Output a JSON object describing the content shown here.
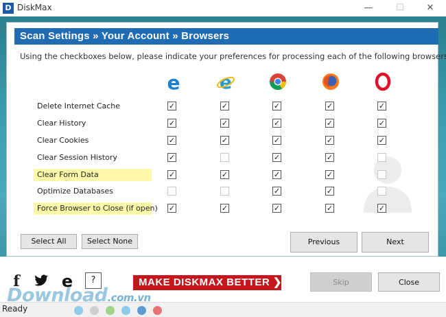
{
  "window": {
    "title": "DiskMax",
    "logo_letter": "D",
    "controls": {
      "minimize": "—",
      "maximize": "☐",
      "close": "✕"
    }
  },
  "header": {
    "title": "Scan Settings  »  Your Account  » Browsers"
  },
  "instructions": "Using the checkboxes below, please indicate your preferences for processing each of the following browsers:",
  "browsers": [
    "edge-icon",
    "internet-explorer-icon",
    "chrome-icon",
    "firefox-icon",
    "opera-icon"
  ],
  "rows": [
    {
      "label": "Delete Internet Cache",
      "highlight": false,
      "checks": [
        true,
        true,
        true,
        true,
        true
      ]
    },
    {
      "label": "Clear History",
      "highlight": false,
      "checks": [
        true,
        true,
        true,
        true,
        true
      ]
    },
    {
      "label": "Clear Cookies",
      "highlight": false,
      "checks": [
        true,
        true,
        true,
        true,
        true
      ]
    },
    {
      "label": "Clear Session History",
      "highlight": false,
      "checks": [
        true,
        false,
        true,
        true,
        false
      ]
    },
    {
      "label": "Clear Form Data",
      "highlight": true,
      "checks": [
        true,
        true,
        true,
        true,
        false
      ]
    },
    {
      "label": "Optimize Databases",
      "highlight": false,
      "checks": [
        false,
        false,
        true,
        true,
        false
      ]
    },
    {
      "label": "Force Browser to Close (if open)",
      "highlight": true,
      "checks": [
        true,
        true,
        true,
        true,
        true
      ]
    }
  ],
  "buttons": {
    "select_all": "Select All",
    "select_none": "Select None",
    "previous": "Previous",
    "next": "Next",
    "skip": "Skip",
    "close": "Close"
  },
  "social": {
    "facebook": "f",
    "help": "?"
  },
  "promo": {
    "label": "MAKE  DISKMAX  BETTER",
    "arrow": "❯"
  },
  "watermark": {
    "brand": "Download",
    "tld": ".com.vn"
  },
  "status": {
    "text": "Ready",
    "dots": [
      "#8ccbea",
      "#cfcfcf",
      "#9fd48a",
      "#8ccbea",
      "#5b9bd0",
      "#e57373"
    ]
  },
  "colors": {
    "header_bg": "#1f6bb4",
    "highlight": "#fdf9a9",
    "promo_bg": "#c4161c",
    "teal_bg": "#3a9cae"
  }
}
